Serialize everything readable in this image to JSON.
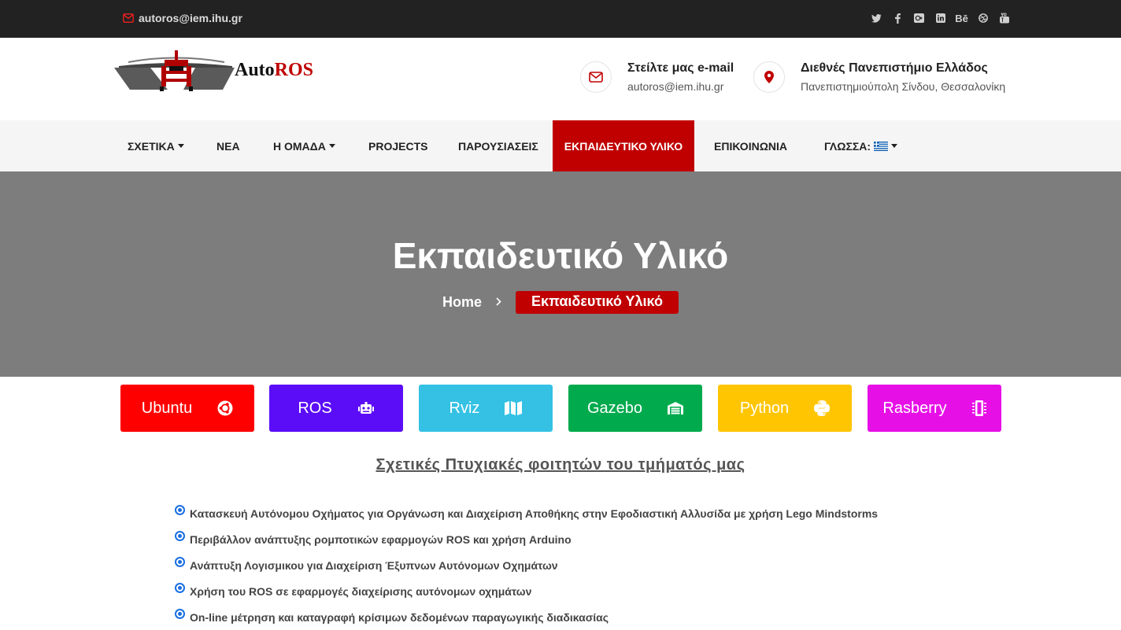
{
  "topbar": {
    "email": "autoros@iem.ihu.gr",
    "social_icons": [
      "twitter-icon",
      "facebook-icon",
      "google-plus-icon",
      "linkedin-icon",
      "behance-icon",
      "dribbble-icon",
      "youtube-icon"
    ],
    "behance_text": "Bē"
  },
  "logo": {
    "text_auto": "Auto",
    "text_ros": "ROS"
  },
  "contact": {
    "email_title": "Στείλτε μας e-mail",
    "email_value": "autoros@iem.ihu.gr",
    "address_title": "Διεθνές Πανεπιστήμιο Ελλάδος",
    "address_value": "Πανεπιστημιούπολη Σίνδου, Θεσσαλονίκη"
  },
  "nav": {
    "items": [
      {
        "label": "ΣΧΕΤΙΚΑ",
        "dropdown": true
      },
      {
        "label": "ΝΕΑ"
      },
      {
        "label": "Η ΟΜΑΔΑ",
        "dropdown": true
      },
      {
        "label": "PROJECTS"
      },
      {
        "label": "ΠΑΡΟΥΣΙΑΣΕΙΣ"
      },
      {
        "label": "ΕΚΠΑΙΔΕΥΤΙΚΟ ΥΛΙΚΟ",
        "active": true
      },
      {
        "label": "ΕΠΙΚΟΙΝΩΝΙΑ"
      },
      {
        "label": "ΓΛΩΣΣΑ:",
        "dropdown": true
      }
    ]
  },
  "hero": {
    "title": "Εκπαιδευτικό Υλικό",
    "breadcrumb_home": "Home",
    "breadcrumb_current": "Εκπαιδευτικό Υλικό"
  },
  "tiles": [
    {
      "label": "Ubuntu",
      "color": "#ff0000",
      "icon": "ubuntu-icon"
    },
    {
      "label": "ROS",
      "color": "#5b0df7",
      "icon": "robot-icon"
    },
    {
      "label": "Rviz",
      "color": "#34c1e4",
      "icon": "map-icon"
    },
    {
      "label": "Gazebo",
      "color": "#00aa4d",
      "icon": "warehouse-icon"
    },
    {
      "label": "Python",
      "color": "#ffc500",
      "icon": "python-icon"
    },
    {
      "label": "Rasberry",
      "color": "#e610e6",
      "icon": "microchip-icon"
    }
  ],
  "section": {
    "title": "Σχετικές Πτυχιακές φοιτητών του τμήματός μας"
  },
  "theses": [
    "Κατασκευή Αυτόνομου Οχήματος για Οργάνωση και Διαχείριση Αποθήκης στην Εφοδιαστική Αλλυσίδα με χρήση Lego Mindstorms",
    "Περιβάλλον ανάπτυξης ρομποτικών εφαρμογών ROS και χρήση Arduino",
    "Ανάπτυξη Λογισμικου για Διαχείριση Έξυπνων Αυτόνομων Οχημάτων",
    "Χρήση του ROS σε εφαρμογές διαχείρισης αυτόνομων οχημάτων",
    "On-line μέτρηση και καταγραφή κρίσιμων δεδομένων παραγωγικής διαδικασίας"
  ],
  "colors": {
    "brand_red": "#c00000",
    "topbar": "#222222",
    "hero_bg": "#7d7d7d",
    "bullet": "#1a6fe0"
  }
}
